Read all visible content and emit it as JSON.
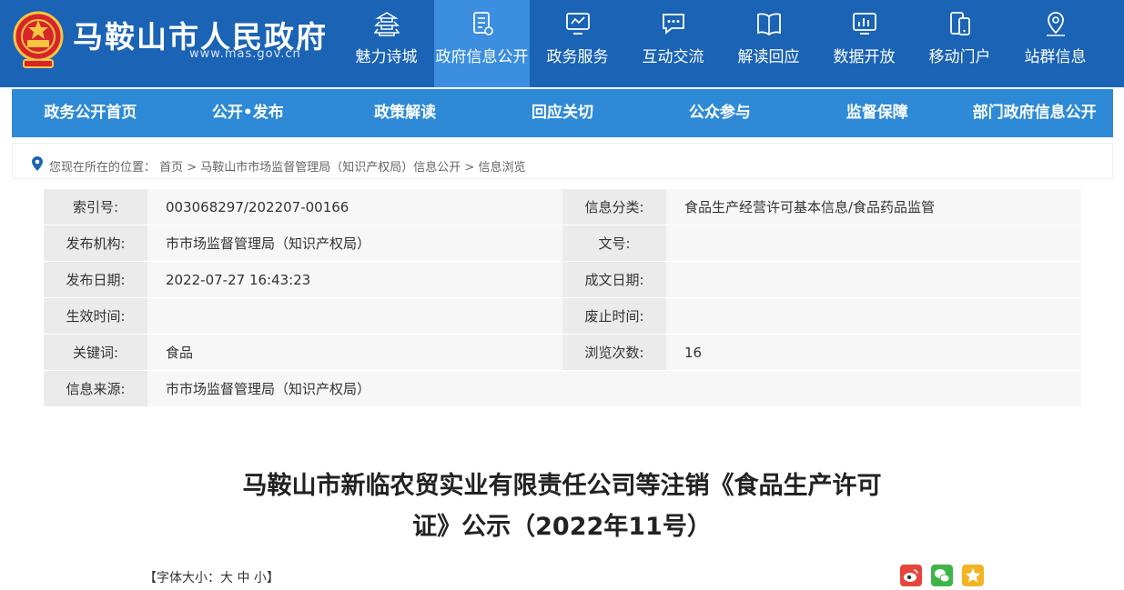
{
  "header": {
    "site_title": "马鞍山市人民政府",
    "site_url": "www.mas.gov.cn",
    "nav": [
      {
        "label": "魅力诗城",
        "icon": "pagoda-icon",
        "active": false
      },
      {
        "label": "政府信息公开",
        "icon": "document-icon",
        "active": true
      },
      {
        "label": "政务服务",
        "icon": "monitor-icon",
        "active": false
      },
      {
        "label": "互动交流",
        "icon": "chat-icon",
        "active": false
      },
      {
        "label": "解读回应",
        "icon": "book-icon",
        "active": false
      },
      {
        "label": "数据开放",
        "icon": "chart-icon",
        "active": false
      },
      {
        "label": "移动门户",
        "icon": "mobile-icon",
        "active": false
      },
      {
        "label": "站群信息",
        "icon": "location-icon",
        "active": false
      }
    ]
  },
  "subnav": [
    "政务公开首页",
    "公开•发布",
    "政策解读",
    "回应关切",
    "公众参与",
    "监督保障",
    "部门政府信息公开"
  ],
  "breadcrumb": "您现在所在的位置： 首页 > 马鞍山市市场监督管理局（知识产权局）信息公开 > 信息浏览",
  "meta": [
    {
      "l1": "索引号:",
      "v1": "003068297/202207-00166",
      "l2": "信息分类:",
      "v2": "食品生产经营许可基本信息/食品药品监管"
    },
    {
      "l1": "发布机构:",
      "v1": "市市场监督管理局（知识产权局）",
      "l2": "文号:",
      "v2": ""
    },
    {
      "l1": "发布日期:",
      "v1": "2022-07-27 16:43:23",
      "l2": "成文日期:",
      "v2": ""
    },
    {
      "l1": "生效时间:",
      "v1": "",
      "l2": "废止时间:",
      "v2": ""
    },
    {
      "l1": "关键词:",
      "v1": "食品",
      "l2": "浏览次数:",
      "v2": "16"
    },
    {
      "l1": "信息来源:",
      "v1": "市市场监督管理局（知识产权局）",
      "l2": "",
      "v2": ""
    }
  ],
  "article": {
    "title_line1": "马鞍山市新临农贸实业有限责任公司等注销《食品生产许可",
    "title_line2": "证》公示（2022年11号）",
    "font_size_label": "【字体大小：大 中 小】"
  },
  "share": [
    {
      "icon": "weibo-icon",
      "color": "#e6453c"
    },
    {
      "icon": "wechat-icon",
      "color": "#3fb549"
    },
    {
      "icon": "star-icon",
      "color": "#f2b422"
    }
  ],
  "colors": {
    "header": "#1a63b5",
    "nav_active": "#3b8ee0",
    "subnav": "#2e8ad6"
  }
}
